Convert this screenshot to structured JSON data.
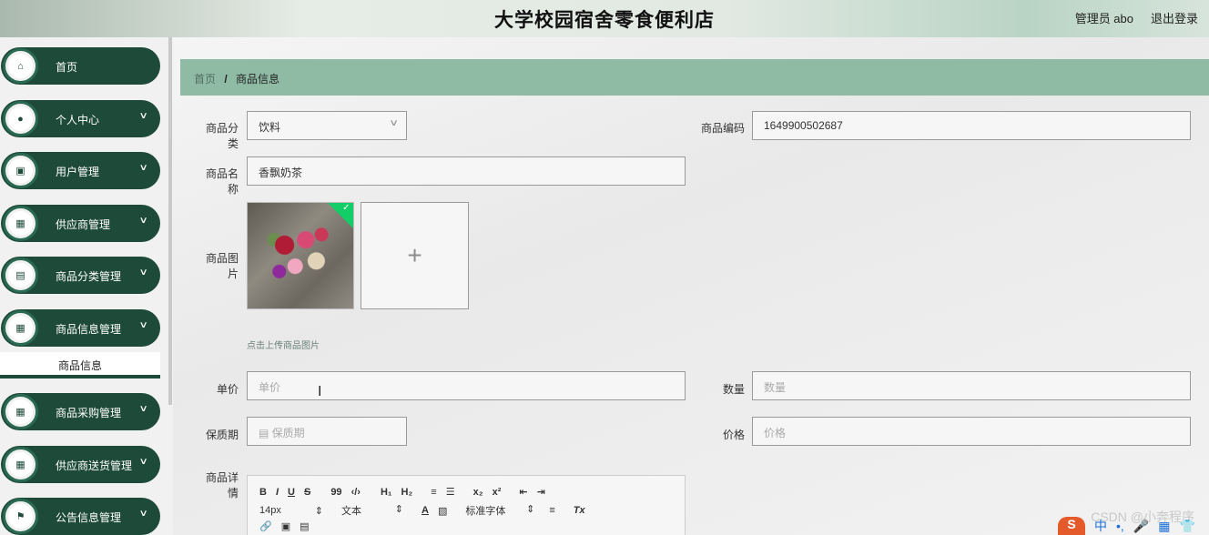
{
  "header": {
    "title": "大学校园宿舍零食便利店",
    "user": "管理员 abo",
    "logout": "退出登录"
  },
  "sidebar": {
    "items": [
      {
        "label": "首页",
        "icon": "home-icon",
        "glyph": "⌂",
        "chevron": false
      },
      {
        "label": "个人中心",
        "icon": "person-icon",
        "glyph": "●",
        "chevron": true
      },
      {
        "label": "用户管理",
        "icon": "chart-icon",
        "glyph": "▣",
        "chevron": true
      },
      {
        "label": "供应商管理",
        "icon": "grid-icon",
        "glyph": "▦",
        "chevron": true
      },
      {
        "label": "商品分类管理",
        "icon": "document-icon",
        "glyph": "▤",
        "chevron": true
      },
      {
        "label": "商品信息管理",
        "icon": "grid-icon",
        "glyph": "▦",
        "chevron": true
      },
      {
        "label": "商品采购管理",
        "icon": "grid-icon",
        "glyph": "▦",
        "chevron": true
      },
      {
        "label": "供应商送货管理",
        "icon": "grid-icon",
        "glyph": "▦",
        "chevron": true
      },
      {
        "label": "公告信息管理",
        "icon": "flag-icon",
        "glyph": "⚑",
        "chevron": true
      }
    ],
    "submenu": {
      "label": "商品信息"
    }
  },
  "breadcrumb": {
    "home": "首页",
    "separator": "/",
    "current": "商品信息"
  },
  "form": {
    "category_label": "商品分类",
    "category_value": "饮料",
    "code_label": "商品编码",
    "code_value": "1649900502687",
    "name_label": "商品名称",
    "name_value": "香飘奶茶",
    "image_label": "商品图片",
    "upload_tip": "点击上传商品图片",
    "upload_plus": "+",
    "price_label": "单价",
    "price_placeholder": "单价",
    "qty_label": "数量",
    "qty_placeholder": "数量",
    "shelf_label": "保质期",
    "shelf_placeholder": "保质期",
    "amount_label": "价格",
    "amount_placeholder": "价格",
    "detail_label": "商品详情"
  },
  "editor": {
    "row1": [
      "B",
      "I",
      "U",
      "S",
      "99",
      "‹/›",
      "H₁",
      "H₂",
      "≡",
      "☰",
      "x₂",
      "x²",
      "⇤",
      "⇥"
    ],
    "size_value": "14px",
    "text_value": "文本",
    "font_value": "标准字体",
    "select_arrow": "⇕",
    "row2_tools": [
      "A",
      "▧",
      "≡",
      "Tx"
    ],
    "row3": [
      "🔗",
      "▣",
      "▤"
    ]
  },
  "watermark": {
    "text": "CSDN @小奔程序",
    "ime": "S",
    "ime_icons": [
      "中",
      "•,",
      "🎤",
      "▦",
      "👕"
    ]
  },
  "colors": {
    "accent": "#1e4a39",
    "breadcrumb_bg": "#8fbba5"
  }
}
